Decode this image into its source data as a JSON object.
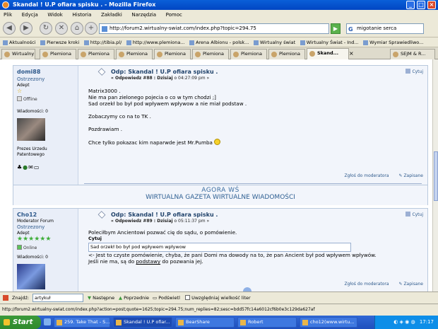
{
  "window": {
    "title": "Skandal ! U.P ofiara spisku . - Mozilla Firefox"
  },
  "menu": [
    "Plik",
    "Edycja",
    "Widok",
    "Historia",
    "Zakładki",
    "Narzędzia",
    "Pomoc"
  ],
  "nav": {
    "url": "http://forum2.wirtualny-swiat.com/index.php?topic=294.75",
    "search_value": "migotanie serca"
  },
  "bookmarks": [
    "Aktualności",
    "Pierwsze kroki",
    "http://tibia.pl/",
    "http://www.plemiona...",
    "Arena Albionu - polsk...",
    "Wirtualny świat",
    "Wirtualny Świat - Ind...",
    "Wymiar Sprawiedliwo..."
  ],
  "tabs": [
    {
      "label": "Wirtualny ...",
      "active": false
    },
    {
      "label": "Plemiona",
      "active": false
    },
    {
      "label": "Plemiona",
      "active": false
    },
    {
      "label": "Plemiona",
      "active": false
    },
    {
      "label": "Plemiona",
      "active": false
    },
    {
      "label": "Plemiona",
      "active": false
    },
    {
      "label": "Plemiona",
      "active": false
    },
    {
      "label": "Plemiona",
      "active": false
    },
    {
      "label": "Skand...",
      "active": true
    },
    {
      "label": "SEJM & R...",
      "active": false
    }
  ],
  "post1": {
    "author": "domi88",
    "title": "Ostrzezony",
    "rank": "Adept",
    "status": "Offline",
    "messages": "Wiadomości: 0",
    "user_text_1": "Prezes Urzedu",
    "user_text_2": "Patentowego",
    "subject": "Odp: Skandal ! U.P ofiara spisku .",
    "meta_prefix": "« Odpowiedz #88 : ",
    "meta_date": "Dzisiaj",
    "meta_time": " o 04:27:09 pm »",
    "quote_label": "Cytuj",
    "lines": [
      "Matrix3000 .",
      "Nie ma pan zielonego pojecia o co w tym chodzi ;]",
      "Sad orzekł bo był pod wpływem wpływow a nie miał podstaw .",
      "",
      "Zobaczymy co na to TK .",
      "",
      "Pozdrawiam .",
      "",
      "Chce tylko pokazac kim naparwde jest Mr.Pumba"
    ],
    "report": "Zgłoś do moderatora",
    "saved": "Zapisane"
  },
  "banner": {
    "line1": "AGORA WŚ",
    "line2": "WIRTUALNA GAZETA WIRTUALNE WIADOMOŚCI"
  },
  "post2": {
    "author": "Cho12",
    "title_1": "Moderator Forum",
    "title_2": "Ostrzezony",
    "rank": "Adept",
    "stars": "★★★★★★",
    "status": "Online",
    "messages": "Wiadomości: 0",
    "subject": "Odp: Skandal ! U.P ofiara spisku .",
    "meta_prefix": "« Odpowiedz #89 : ",
    "meta_date": "Dzisiaj",
    "meta_time": " o 05:11:37 pm »",
    "quote_label": "Cytuj",
    "line1": "Poleciłbym Ancientowi pozwać cię do sądu, o pomówienie.",
    "quote_title": "Cytuj",
    "quote_text": "Sad orzekł bo był pod wpływem wpływow",
    "line2": "<- Jest to czyste pomówienie, chyba, że pani Domi ma dowody na to, że pan Ancient był pod wpływem wpływów.",
    "line3_a": "Jeśli nie ma, są do ",
    "line3_link": "podstawy",
    "line3_b": " do pozwania jej.",
    "report": "Zgłoś do moderatora",
    "saved": "Zapisane"
  },
  "findbar": {
    "label": "Znajdź:",
    "value": "artykuł",
    "next": "Następne",
    "prev": "Poprzednie",
    "highlight": "Podświetl",
    "match_case": "Uwzględniaj wielkość liter"
  },
  "status": "http://forum2.wirtualny-swiat.com/index.php?action=post;quote=1625;topic=294.75;num_replies=82;sesc=bdd57fc14a6012cf6b0e3c129da627af",
  "taskbar": {
    "start": "Start",
    "tasks": [
      {
        "label": "259. Take That - S...",
        "active": false
      },
      {
        "label": "Skandal ! U.P ofiar...",
        "active": true
      },
      {
        "label": "BearShare",
        "active": false
      },
      {
        "label": "Robert",
        "active": false
      },
      {
        "label": "cho12(www.wirtu...",
        "active": false
      }
    ],
    "clock": "17:17"
  }
}
